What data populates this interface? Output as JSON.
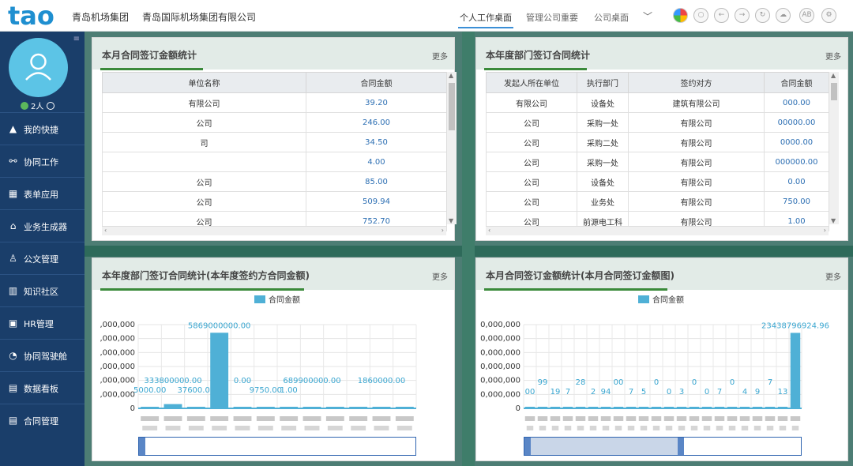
{
  "header": {
    "logo_text": "tao",
    "org_short": "青岛机场集团",
    "org_full": "青岛国际机场集团有限公司",
    "tabs": [
      {
        "label": "个人工作桌面",
        "active": true
      },
      {
        "label": "管理公司重要",
        "active": false
      },
      {
        "label": "公司桌面",
        "active": false
      }
    ],
    "more_tabs": "﹀",
    "toolbar_labels": [
      "AB"
    ]
  },
  "sidebar": {
    "online_count": "2人",
    "items": [
      {
        "label": "我的快捷",
        "icon": "triangle-icon"
      },
      {
        "label": "协同工作",
        "icon": "share-icon"
      },
      {
        "label": "表单应用",
        "icon": "table-icon"
      },
      {
        "label": "业务生成器",
        "icon": "house-icon"
      },
      {
        "label": "公文管理",
        "icon": "stamp-icon"
      },
      {
        "label": "知识社区",
        "icon": "books-icon"
      },
      {
        "label": "HR管理",
        "icon": "id-card-icon"
      },
      {
        "label": "协同驾驶舱",
        "icon": "gauge-icon"
      },
      {
        "label": "数据看板",
        "icon": "document-icon"
      },
      {
        "label": "合同管理",
        "icon": "document-icon"
      }
    ]
  },
  "panel1": {
    "title": "本月合同签订金额统计",
    "more": "更多",
    "columns": [
      "单位名称",
      "合同金额"
    ],
    "rows": [
      {
        "unit": "有限公司",
        "amount": "39.20"
      },
      {
        "unit": "公司",
        "amount": "246.00"
      },
      {
        "unit": "司",
        "amount": "34.50"
      },
      {
        "unit": "",
        "amount": "4.00"
      },
      {
        "unit": "公司",
        "amount": "85.00"
      },
      {
        "unit": "公司",
        "amount": "509.94"
      },
      {
        "unit": "公司",
        "amount": "752.70"
      }
    ]
  },
  "panel2": {
    "title": "本年度部门签订合同统计",
    "more": "更多",
    "columns": [
      "发起人所在单位",
      "执行部门",
      "签约对方",
      "合同金额"
    ],
    "rows": [
      {
        "unit": "有限公司",
        "dept": "设备处",
        "party": "建筑有限公司",
        "amount": "000.00"
      },
      {
        "unit": "公司",
        "dept": "采购一处",
        "party": "有限公司",
        "amount": "00000.00"
      },
      {
        "unit": "公司",
        "dept": "采购二处",
        "party": "有限公司",
        "amount": "0000.00"
      },
      {
        "unit": "公司",
        "dept": "采购一处",
        "party": "有限公司",
        "amount": "000000.00"
      },
      {
        "unit": "公司",
        "dept": "设备处",
        "party": "有限公司",
        "amount": "0.00"
      },
      {
        "unit": "公司",
        "dept": "业务处",
        "party": "有限公司",
        "amount": "750.00"
      },
      {
        "unit": "公司",
        "dept": "前源电工科",
        "party": "有限公司",
        "amount": "1.00"
      }
    ]
  },
  "panel3": {
    "title": "本年度部门签订合同统计(本年度签约方合同金额)",
    "more": "更多",
    "chart_data": {
      "type": "bar",
      "legend": [
        "合同金额"
      ],
      "color": "#4fb0d6",
      "ytick_labels": [
        ",000,000",
        ",000,000",
        ",000,000",
        ",000,000",
        ",000,000",
        ",000,000",
        "0"
      ],
      "categories": [
        "",
        "",
        "",
        "",
        "",
        "",
        "",
        "",
        "",
        "",
        "",
        ""
      ],
      "values": [
        0.6,
        3.3,
        0.35,
        58.69,
        0.3,
        0.2,
        0.15,
        0.6,
        0.1,
        0.05,
        0.1,
        0.1
      ],
      "data_labels": [
        "5000.00",
        "333800000.00",
        "37600.00",
        "5869000000.00",
        "0.00",
        "9750.00",
        "1.00",
        "689900000.00",
        "",
        "",
        "1860000.00",
        ""
      ],
      "ylim": [
        0,
        65
      ]
    }
  },
  "panel4": {
    "title": "本月合同签订金额统计(本月合同签订金额图)",
    "more": "更多",
    "chart_data": {
      "type": "bar",
      "legend": [
        "合同金额"
      ],
      "color": "#4fb0d6",
      "ytick_labels": [
        "0,000,000",
        "0,000,000",
        "0,000,000",
        "0,000,000",
        "0,000,000",
        "0,000,000",
        "0"
      ],
      "categories": [
        "",
        "",
        "",
        "",
        "",
        "",
        "",
        "",
        "",
        "",
        "",
        "",
        "",
        "",
        "",
        "",
        "",
        "",
        "",
        "",
        "",
        ""
      ],
      "values": [
        0.2,
        0.2,
        0.2,
        0.2,
        0.2,
        0.2,
        0.2,
        0.2,
        0.2,
        0.2,
        0.3,
        0.4,
        0.3,
        0.2,
        0.2,
        0.2,
        0.2,
        0.2,
        0.2,
        0.2,
        0.3,
        234.38
      ],
      "data_labels": [
        "00",
        "99",
        "19",
        "7",
        "28",
        "2",
        "94",
        "00",
        "7",
        "5",
        "0",
        "0",
        "3",
        "0",
        "0",
        "7",
        "0",
        "4",
        "9",
        "7",
        "13",
        "23438796924.96"
      ],
      "ylim": [
        0,
        260
      ]
    }
  }
}
